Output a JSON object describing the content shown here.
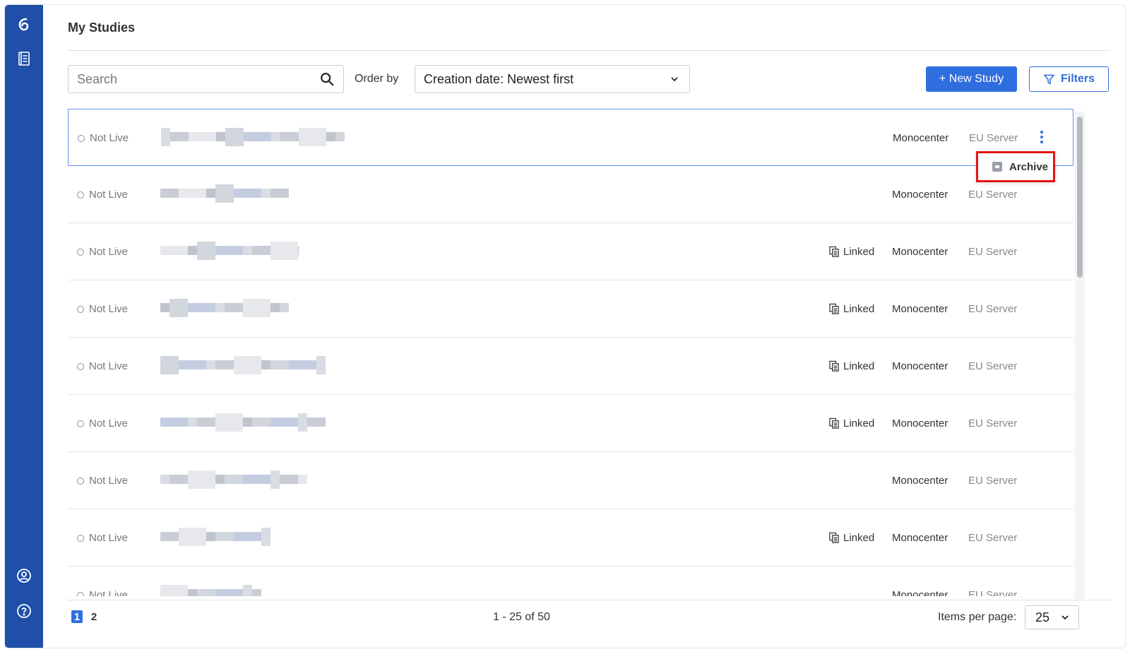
{
  "sidebar": {
    "icons": [
      "logo-icon",
      "notebook-icon",
      "user-circle-icon",
      "help-icon"
    ]
  },
  "header": {
    "title": "My Studies"
  },
  "toolbar": {
    "search_placeholder": "Search",
    "order_label": "Order by",
    "order_value": "Creation date: Newest first",
    "new_study_label": "+ New Study",
    "filters_label": "Filters"
  },
  "rows": [
    {
      "status": "Not Live",
      "linked": "",
      "type": "Monocenter",
      "server": "EU Server"
    },
    {
      "status": "Not Live",
      "linked": "",
      "type": "Monocenter",
      "server": "EU Server"
    },
    {
      "status": "Not Live",
      "linked": "Linked",
      "type": "Monocenter",
      "server": "EU Server"
    },
    {
      "status": "Not Live",
      "linked": "Linked",
      "type": "Monocenter",
      "server": "EU Server"
    },
    {
      "status": "Not Live",
      "linked": "Linked",
      "type": "Monocenter",
      "server": "EU Server"
    },
    {
      "status": "Not Live",
      "linked": "Linked",
      "type": "Monocenter",
      "server": "EU Server"
    },
    {
      "status": "Not Live",
      "linked": "",
      "type": "Monocenter",
      "server": "EU Server"
    },
    {
      "status": "Not Live",
      "linked": "Linked",
      "type": "Monocenter",
      "server": "EU Server"
    },
    {
      "status": "Not Live",
      "linked": "",
      "type": "Monocenter",
      "server": "EU Server"
    }
  ],
  "row_menu": {
    "archive_label": "Archive"
  },
  "pagination": {
    "pages": [
      "1",
      "2"
    ],
    "current_page": "1",
    "range_text": "1 - 25 of 50",
    "items_per_page_label": "Items per page:",
    "items_per_page_value": "25"
  },
  "colors": {
    "sidebar": "#1f4fa8",
    "accent": "#2f6ede",
    "highlight": "#e11515"
  }
}
